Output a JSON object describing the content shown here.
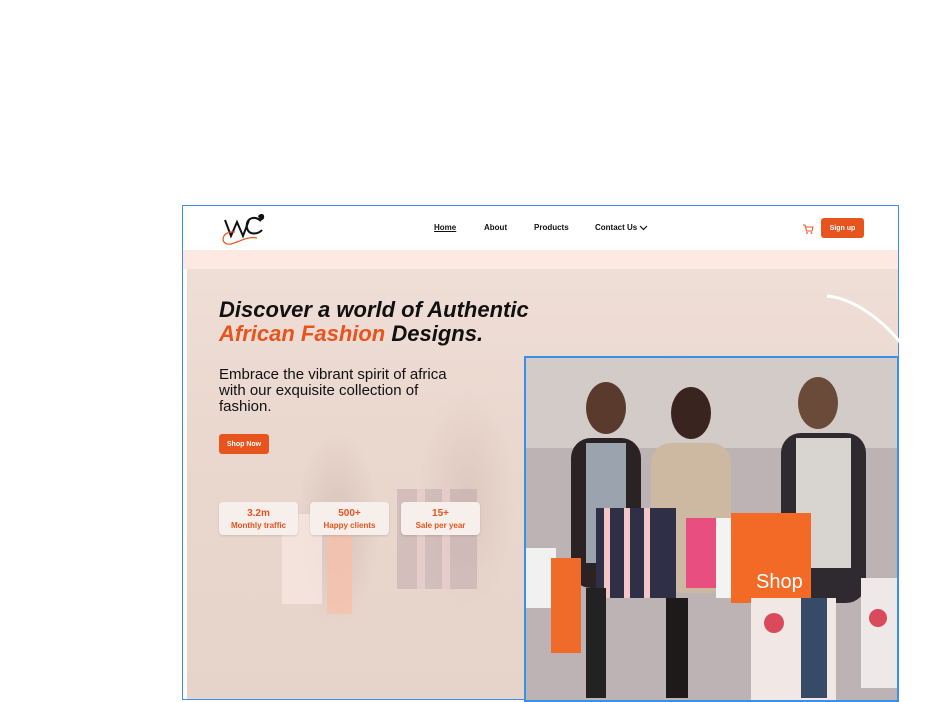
{
  "nav": {
    "links": [
      "Home",
      "About",
      "Products",
      "Contact Us"
    ],
    "signup_label": "Sign up"
  },
  "hero": {
    "title_line1": "Discover a world of Authentic",
    "title_accent": "African Fashion",
    "title_rest": " Designs.",
    "subtitle": "Embrace the vibrant spirit of africa with our exquisite collection of fashion.",
    "shop_button": "Shop Now",
    "stats": [
      {
        "value": "3.2m",
        "label": "Monthly traffic"
      },
      {
        "value": "500+",
        "label": "Happy  clients"
      },
      {
        "value": "15+",
        "label": "Sale per year"
      }
    ]
  },
  "photo": {
    "bag_text": "Shop"
  },
  "colors": {
    "accent": "#e8541e",
    "selection": "#3b8fe8",
    "band": "#fde9e2"
  }
}
